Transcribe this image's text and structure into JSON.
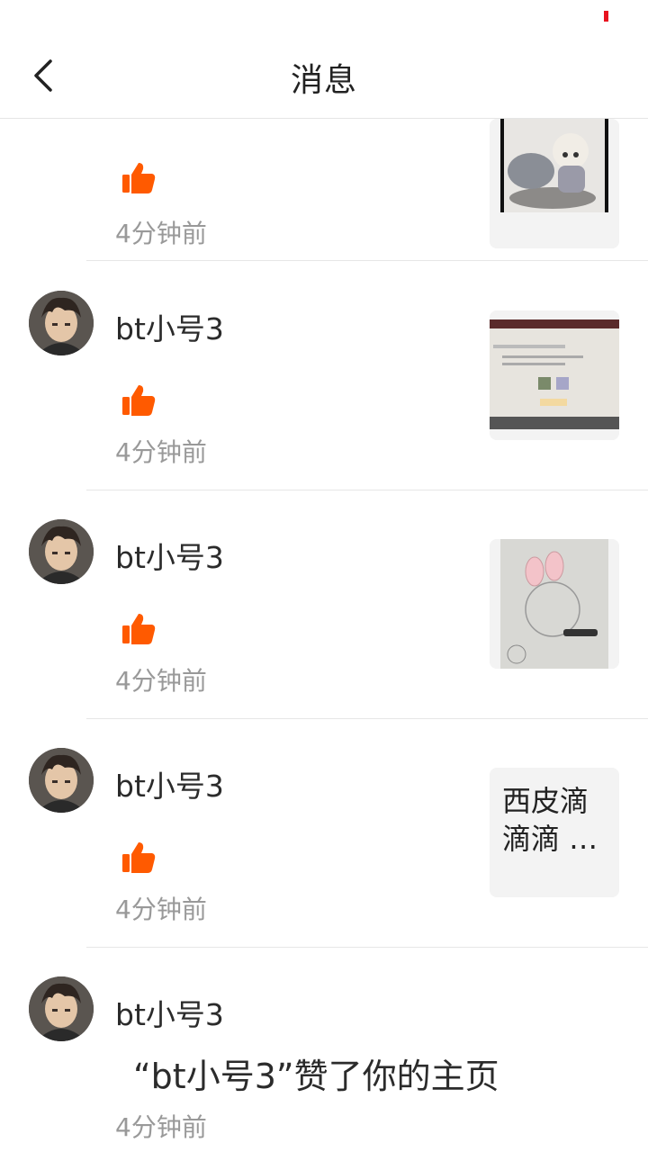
{
  "header": {
    "title": "消息"
  },
  "items": [
    {
      "username": "",
      "time": "4分钟前",
      "thumb_type": "image"
    },
    {
      "username": "bt小号3",
      "time": "4分钟前",
      "thumb_type": "image"
    },
    {
      "username": "bt小号3",
      "time": "4分钟前",
      "thumb_type": "image"
    },
    {
      "username": "bt小号3",
      "time": "4分钟前",
      "thumb_type": "text",
      "thumb_text_line1": "西皮滴",
      "thumb_text_line2": "滴滴 …"
    },
    {
      "username": "bt小号3",
      "message": "“bt小号3”赞了你的主页",
      "time": "4分钟前"
    }
  ],
  "colors": {
    "like": "#ff5a00",
    "time": "#999999",
    "accent": "#e8131f"
  },
  "icons": {
    "back": "chevron-left-icon",
    "like": "thumbs-up-icon"
  }
}
